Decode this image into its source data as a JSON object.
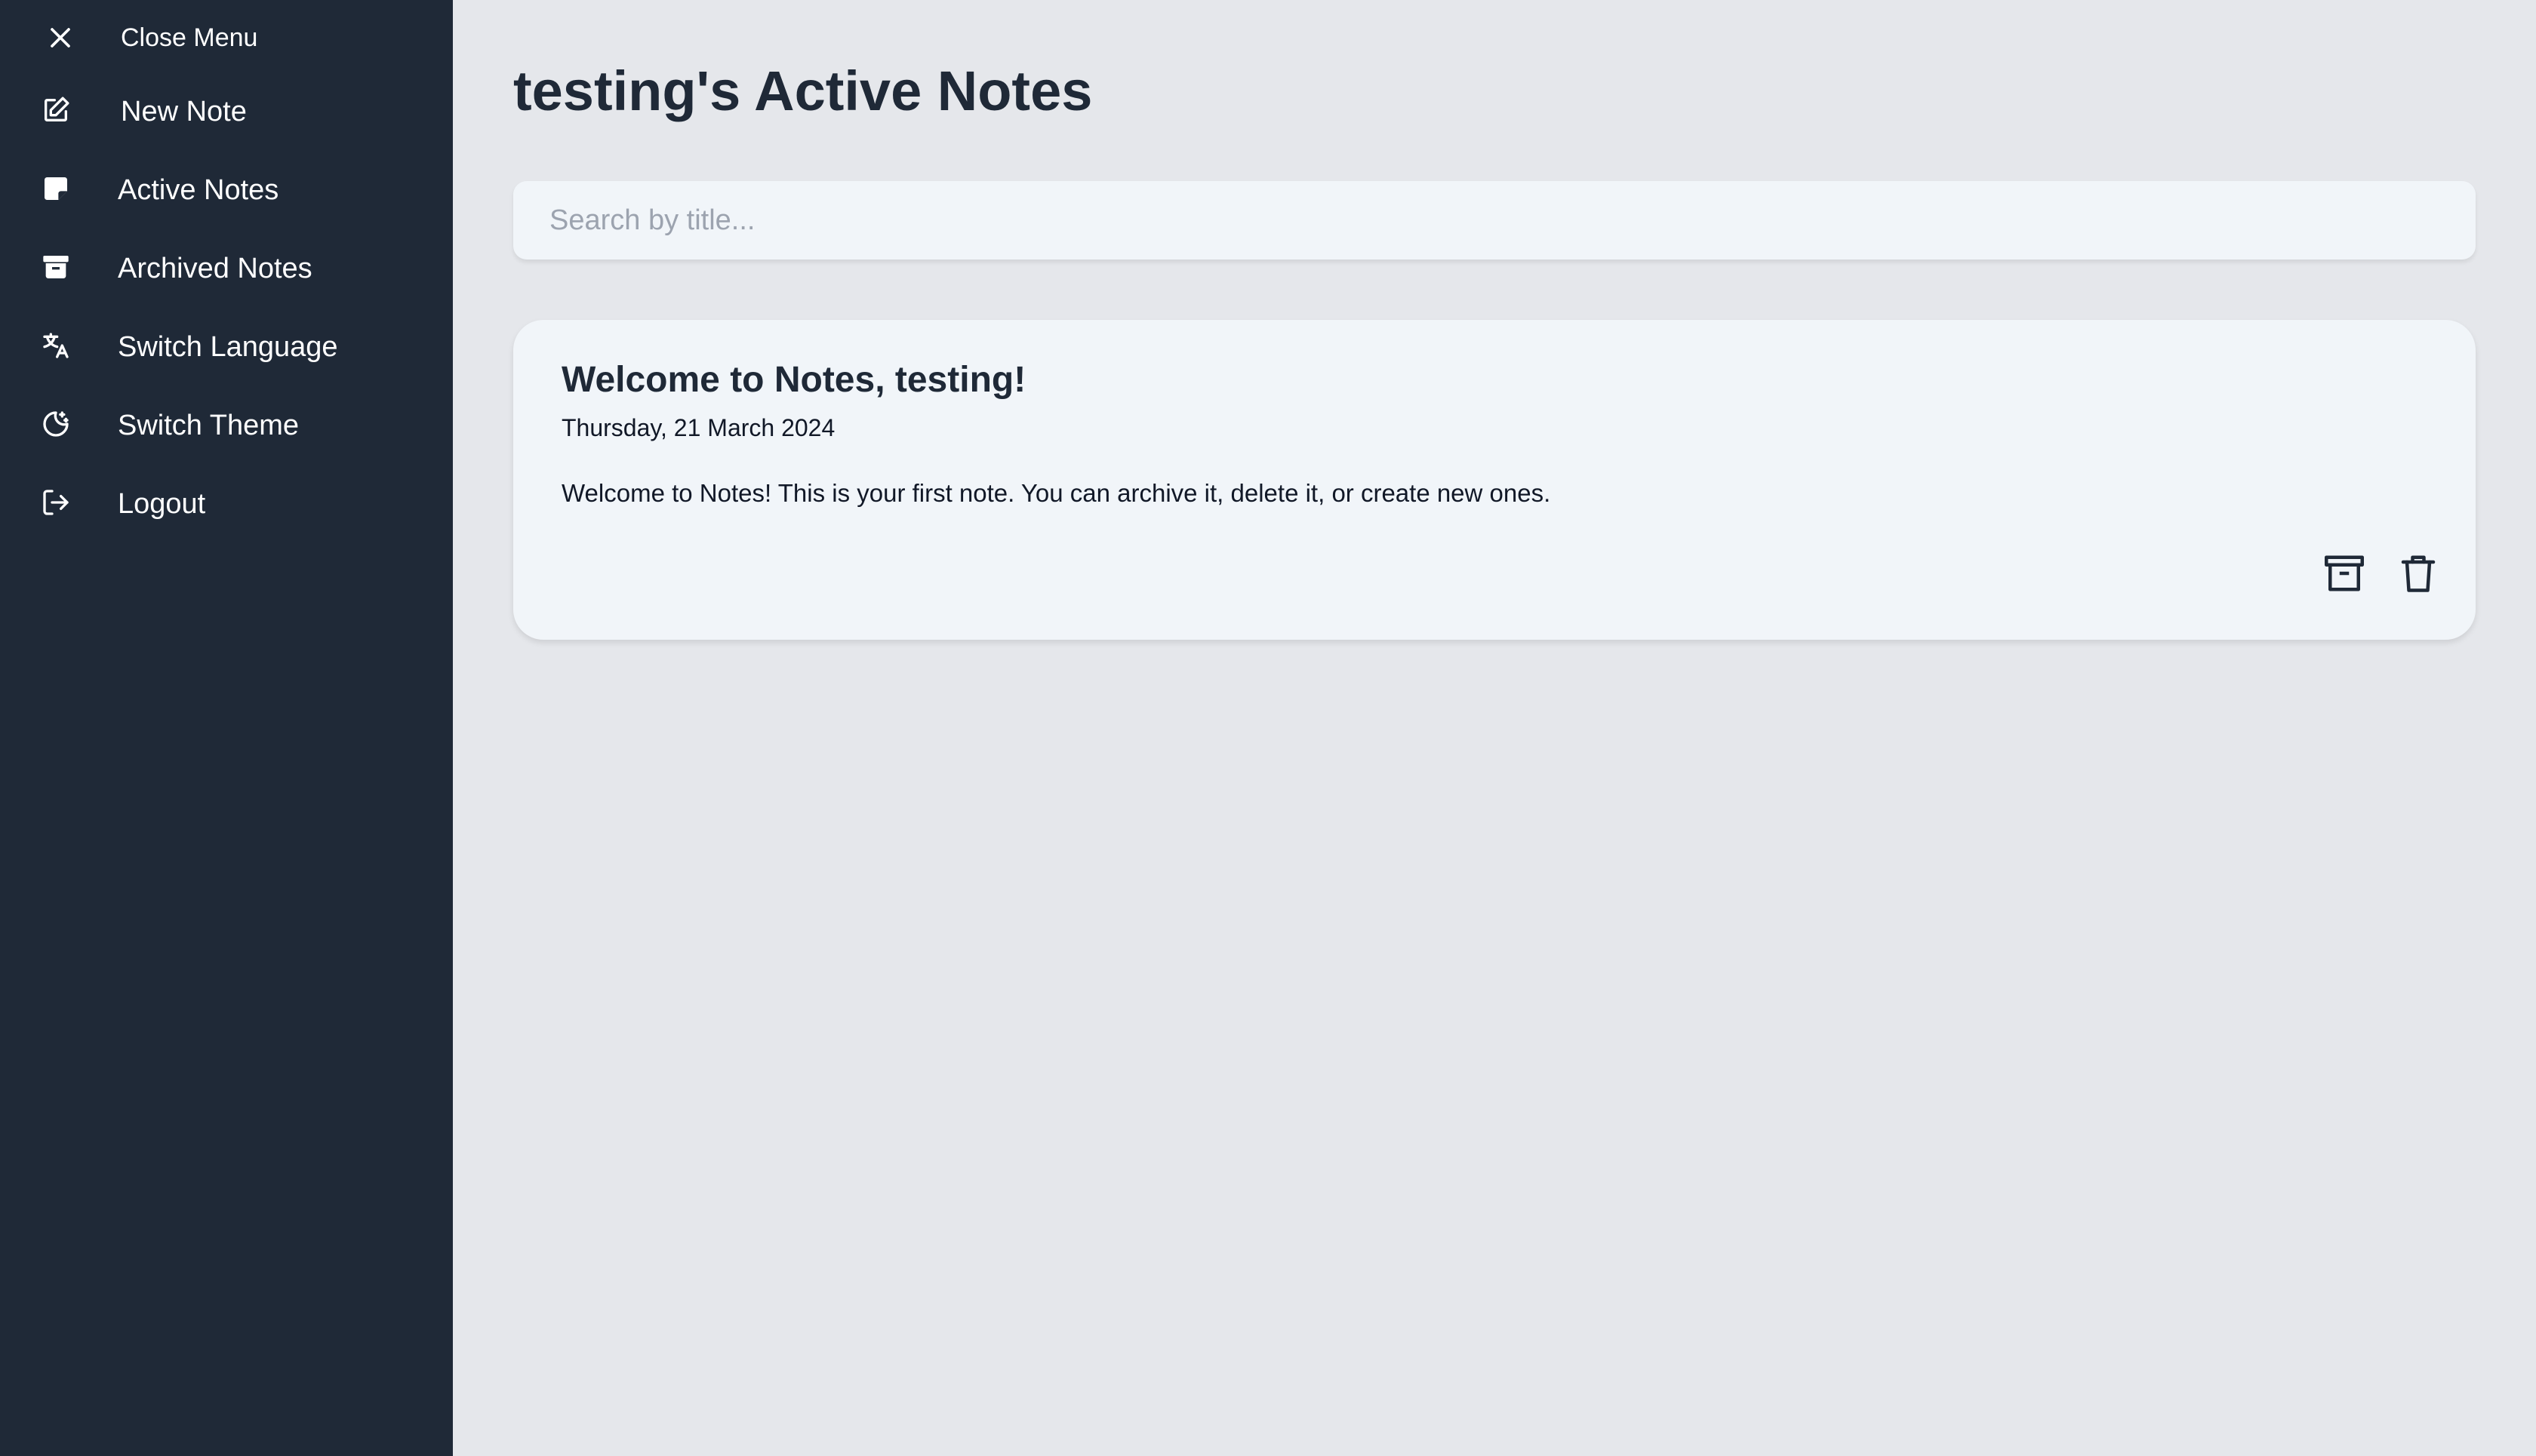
{
  "sidebar": {
    "close_label": "Close Menu",
    "items": [
      {
        "label": "New Note",
        "icon": "edit-icon"
      },
      {
        "label": "Active Notes",
        "icon": "sticky-note-icon"
      },
      {
        "label": "Archived Notes",
        "icon": "archive-icon"
      },
      {
        "label": "Switch Language",
        "icon": "translate-icon"
      },
      {
        "label": "Switch Theme",
        "icon": "moon-icon"
      },
      {
        "label": "Logout",
        "icon": "logout-icon"
      }
    ]
  },
  "main": {
    "title": "testing's Active Notes",
    "search": {
      "placeholder": "Search by title...",
      "value": ""
    },
    "notes": [
      {
        "title": "Welcome to Notes, testing!",
        "date": "Thursday, 21 March 2024",
        "body": "Welcome to Notes! This is your first note. You can archive it, delete it, or create new ones.",
        "actions": [
          "archive-icon",
          "trash-icon"
        ]
      }
    ]
  },
  "colors": {
    "sidebar_bg": "#1f2937",
    "page_bg": "#e5e7eb",
    "card_bg": "#f1f5f9",
    "text_dark": "#1f2937",
    "placeholder": "#9ca3af"
  }
}
